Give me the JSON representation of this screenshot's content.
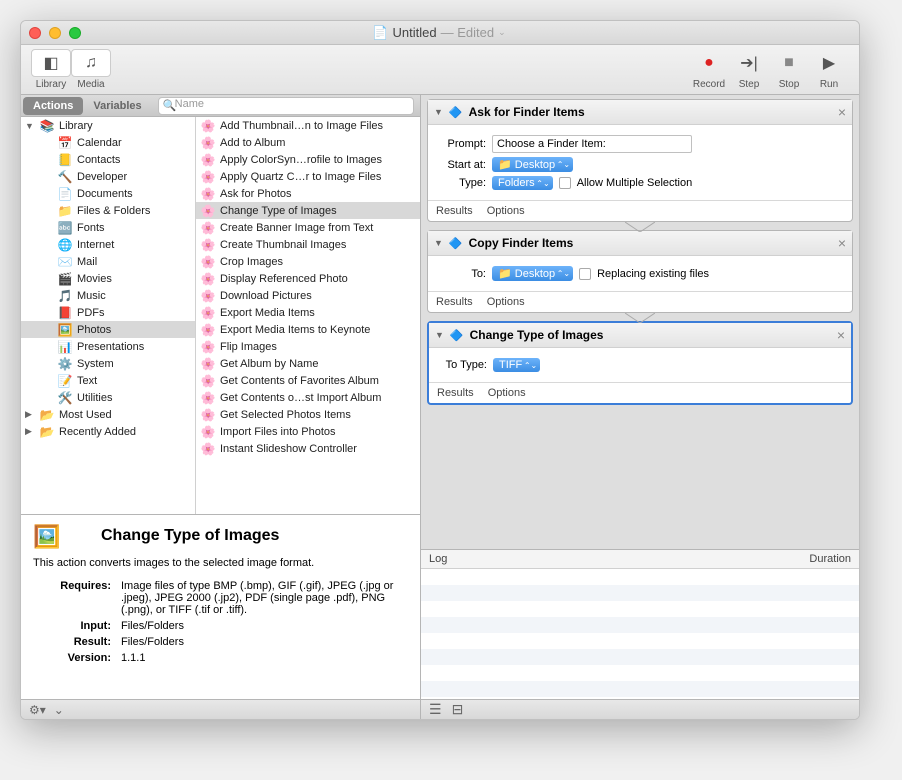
{
  "window": {
    "title": "Untitled",
    "edited": "— Edited"
  },
  "toolbar": {
    "library": "Library",
    "media": "Media",
    "record": "Record",
    "step": "Step",
    "stop": "Stop",
    "run": "Run"
  },
  "tabs": {
    "actions": "Actions",
    "variables": "Variables",
    "search_placeholder": "Name"
  },
  "categories": [
    {
      "label": "Library",
      "level": 0,
      "expanded": true
    },
    {
      "label": "Calendar",
      "level": 1
    },
    {
      "label": "Contacts",
      "level": 1
    },
    {
      "label": "Developer",
      "level": 1
    },
    {
      "label": "Documents",
      "level": 1
    },
    {
      "label": "Files & Folders",
      "level": 1
    },
    {
      "label": "Fonts",
      "level": 1
    },
    {
      "label": "Internet",
      "level": 1
    },
    {
      "label": "Mail",
      "level": 1
    },
    {
      "label": "Movies",
      "level": 1
    },
    {
      "label": "Music",
      "level": 1
    },
    {
      "label": "PDFs",
      "level": 1
    },
    {
      "label": "Photos",
      "level": 1,
      "selected": true
    },
    {
      "label": "Presentations",
      "level": 1
    },
    {
      "label": "System",
      "level": 1
    },
    {
      "label": "Text",
      "level": 1
    },
    {
      "label": "Utilities",
      "level": 1
    },
    {
      "label": "Most Used",
      "level": 0
    },
    {
      "label": "Recently Added",
      "level": 0
    }
  ],
  "actions": [
    "Add Thumbnail…n to Image Files",
    "Add to Album",
    "Apply ColorSyn…rofile to Images",
    "Apply Quartz C…r to Image Files",
    "Ask for Photos",
    "Change Type of Images",
    "Create Banner Image from Text",
    "Create Thumbnail Images",
    "Crop Images",
    "Display Referenced Photo",
    "Download Pictures",
    "Export Media Items",
    "Export Media Items to Keynote",
    "Flip Images",
    "Get Album by Name",
    "Get Contents of Favorites Album",
    "Get Contents o…st Import Album",
    "Get Selected Photos Items",
    "Import Files into Photos",
    "Instant Slideshow Controller"
  ],
  "actions_selected": 5,
  "info": {
    "title": "Change Type of Images",
    "desc": "This action converts images to the selected image format.",
    "requires_label": "Requires:",
    "requires": "Image files of type BMP (.bmp), GIF (.gif), JPEG (.jpg or .jpeg), JPEG 2000 (.jp2), PDF (single page .pdf), PNG (.png), or TIFF (.tif or .tiff).",
    "input_label": "Input:",
    "input": "Files/Folders",
    "result_label": "Result:",
    "result": "Files/Folders",
    "version_label": "Version:",
    "version": "1.1.1"
  },
  "workflow": [
    {
      "title": "Ask for Finder Items",
      "rows": [
        {
          "label": "Prompt:",
          "type": "text",
          "value": "Choose a Finder Item:"
        },
        {
          "label": "Start at:",
          "type": "select",
          "value": "Desktop",
          "icon": "📁"
        },
        {
          "label": "Type:",
          "type": "select",
          "value": "Folders",
          "checkbox": "Allow Multiple Selection"
        }
      ],
      "results": "Results",
      "options": "Options"
    },
    {
      "title": "Copy Finder Items",
      "rows": [
        {
          "label": "To:",
          "type": "select",
          "value": "Desktop",
          "icon": "📁",
          "checkbox": "Replacing existing files"
        }
      ],
      "results": "Results",
      "options": "Options"
    },
    {
      "title": "Change Type of Images",
      "active": true,
      "rows": [
        {
          "label": "To Type:",
          "type": "select",
          "value": "TIFF"
        }
      ],
      "results": "Results",
      "options": "Options"
    }
  ],
  "log": {
    "col1": "Log",
    "col2": "Duration"
  }
}
